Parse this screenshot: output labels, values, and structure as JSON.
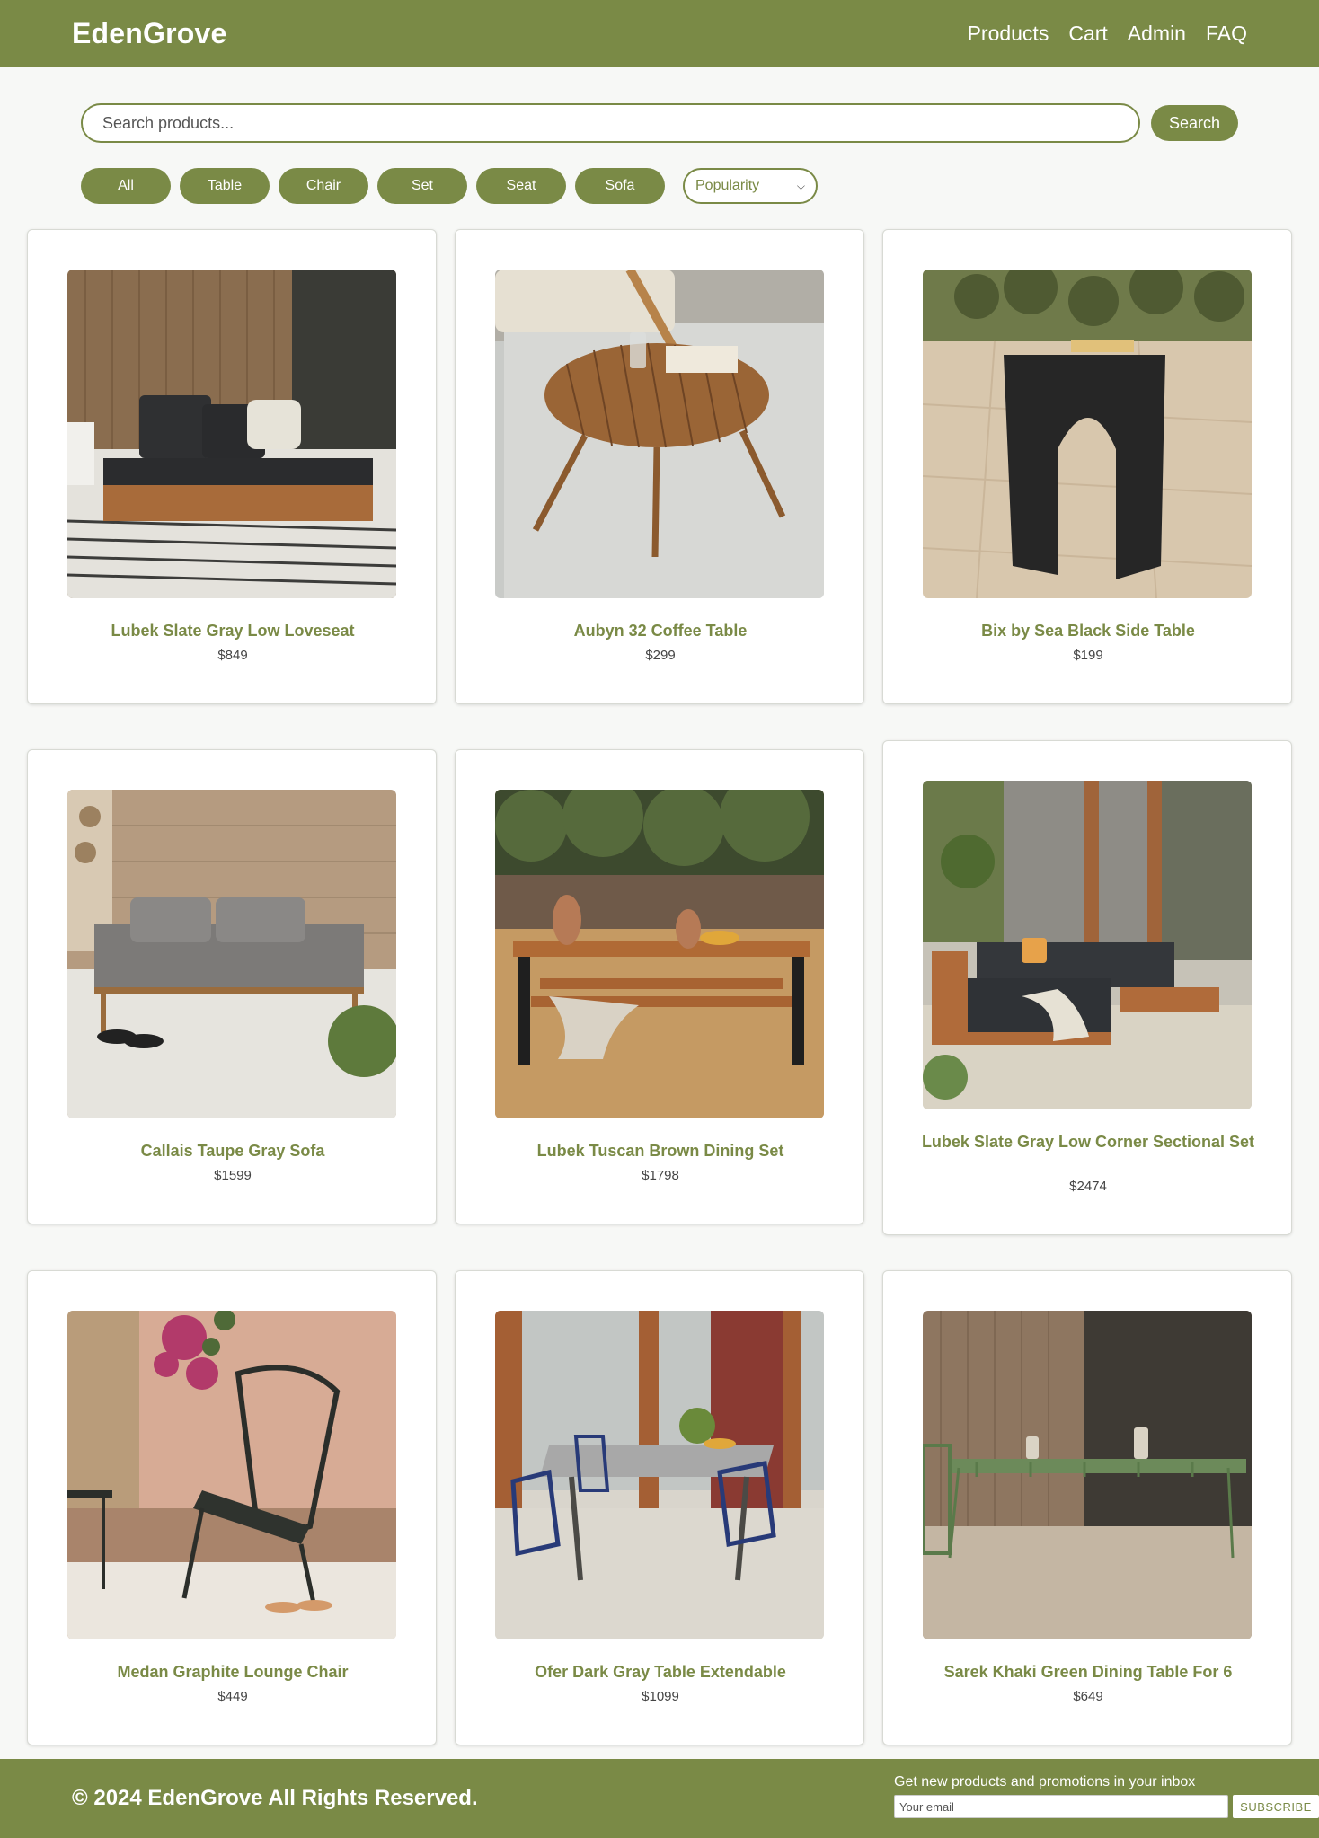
{
  "header": {
    "brand": "EdenGrove",
    "nav": [
      "Products",
      "Cart",
      "Admin",
      "FAQ"
    ]
  },
  "search": {
    "placeholder": "Search products...",
    "button_label": "Search"
  },
  "filters": {
    "categories": [
      "All",
      "Table",
      "Chair",
      "Set",
      "Seat",
      "Sofa"
    ],
    "sort_selected": "Popularity"
  },
  "products": [
    {
      "name": "Lubek Slate Gray Low Loveseat",
      "price": "$849"
    },
    {
      "name": "Aubyn 32 Coffee Table",
      "price": "$299"
    },
    {
      "name": "Bix by Sea Black Side Table",
      "price": "$199"
    },
    {
      "name": "Callais Taupe Gray Sofa",
      "price": "$1599"
    },
    {
      "name": "Lubek Tuscan Brown Dining Set",
      "price": "$1798"
    },
    {
      "name": "Lubek Slate Gray Low Corner Sectional Set",
      "price": "$2474"
    },
    {
      "name": "Medan Graphite Lounge Chair",
      "price": "$449"
    },
    {
      "name": "Ofer Dark Gray Table Extendable",
      "price": "$1099"
    },
    {
      "name": "Sarek Khaki Green Dining Table For 6",
      "price": "$649"
    }
  ],
  "footer": {
    "copyright": "© 2024 EdenGrove All Rights Reserved.",
    "newsletter_title": "Get new products and promotions in your inbox",
    "email_placeholder": "Your email",
    "subscribe_label": "SUBSCRIBE"
  },
  "colors": {
    "brand_green": "#7a8a46",
    "page_background": "#f7f8f6"
  }
}
